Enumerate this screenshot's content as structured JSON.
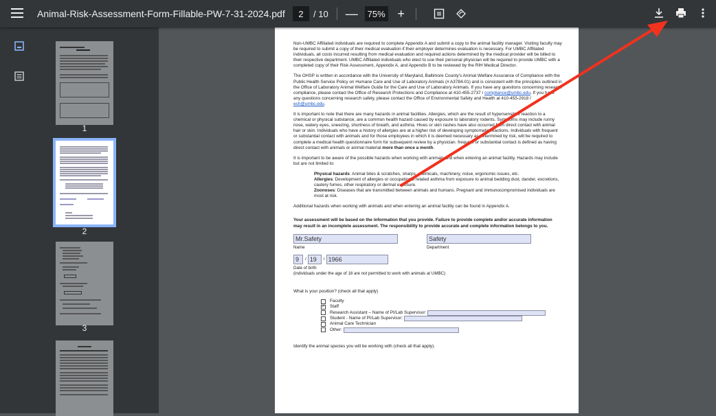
{
  "toolbar": {
    "title": "Animal-Risk-Assessment-Form-Fillable-PW-7-31-2024.pdf",
    "current_page": "2",
    "total_pages": "/ 10",
    "zoom": "75%",
    "zoom_out": "—",
    "zoom_in": "+"
  },
  "sidebar": {
    "thumbnails": [
      {
        "number": "1"
      },
      {
        "number": "2"
      },
      {
        "number": "3"
      }
    ]
  },
  "document": {
    "para1": "Non-UMBC Affiliated individuals are required to complete Appendix A and submit a copy to the animal facility manager. Visiting faculty may be required to submit a copy of their medical evaluation if their employer determines evaluation is necessary. For UMBC Affiliated individuals, all costs incurred resulting from medical evaluation and required actions determined by the medical provider will be billed to their respective department. UMBC Affiliated individuals who elect to use their personal physician will be required to provide UMBC with a completed copy of their Risk Assessment, Appendix A, and Appendix B to be reviewed by the RIH Medical Director.",
    "para2a": "The OHSP is written in accordance with the University of Maryland, Baltimore County's Animal Welfare Assurance of Compliance with the Public Health Service Policy on Humane Care and Use of Laboratory Animals (# A3784-01) and is consistent with the principles outlined in the Office of Laboratory Animal Welfare Guide for the Care and Use of Laboratory Animals. If you have any questions concerning research compliance, please contact the Office of Research Protections and Compliance at 410-455-2737 / ",
    "para2_link1": "compliance@umbc.edu",
    "para2b": ". If you have any questions concerning research safety, please contact the Office of Environmental Safety and Health at 410-455-2918 / ",
    "para2_link2": "esh@umbc.edu",
    "para2c": ".",
    "para3a": "It is important to note that there are many hazards in animal facilities. Allergies, which are the result of hypersensitive reaction to a chemical or physical substance, are a common health hazard caused by exposure to laboratory rodents. Symptoms may include runny nose, watery eyes, sneezing, shortness of breath, and asthma. Hives or skin rashes have also occurred from direct contact with animal hair or skin. Individuals who have a history of allergies are at a higher risk of developing symptomatic reactions. Individuals with frequent or substantial contact with animals and for those employees in which it is deemed necessary as determined by risk, will be required to complete a medical health questionnaire form for subsequent review by a physician. frequent or substantial contact is defined as having direct contact with animals or animal material ",
    "para3_bold": "more than once a month",
    "para3b": ".",
    "para4": "It is important to be aware of the possible hazards when working with animals and when entering an animal facility. Hazards may include but are not limited to:",
    "hazards": [
      {
        "label": "Physical hazards",
        "text": ": Animal bites & scratches, sharps, chemicals, machinery, noise, ergonomic issues, etc."
      },
      {
        "label": "Allergies",
        "text": ": Development of allergies or occupational related asthma from exposure to animal bedding dust, dander, excretions, cautery fumes, other respiratory or dermal exposure."
      },
      {
        "label": "Zoonoses",
        "text": ": Diseases that are transmitted between animals and humans. Pregnant and immunocompromised individuals are most at risk."
      }
    ],
    "para5": "Additional hazards when working with animals and when entering an animal facility can be found in Appendix A.",
    "para6": "Your assessment will be based on the information that you provide.  Failure to provide complete and/or accurate information may result in an incomplete assessment.  The responsibility to provide accurate and complete information belongs to you.",
    "name_value": "Mr.Safety",
    "name_label": "Name",
    "department_value": "Safety",
    "department_label": "Department",
    "dob_month": "9",
    "dob_day": "19",
    "dob_year": "1966",
    "dob_sep1": "/",
    "dob_sep2": "/",
    "dob_label": "Date of birth",
    "dob_note": "(individuals under the age of 18 are not permitted to work with animals at UMBC)",
    "position_question": "What is your position? (check all that apply)",
    "positions": [
      {
        "label": "Faculty",
        "checked": ""
      },
      {
        "label": "Staff",
        "checked": "✓"
      },
      {
        "label": "Research Assistant – Name of PI/Lab Supervisor:",
        "checked": ""
      },
      {
        "label": "Student - Name of PI/Lab Supervisor:",
        "checked": ""
      },
      {
        "label": "Animal Care Technician",
        "checked": ""
      },
      {
        "label": "Other:",
        "checked": ""
      }
    ],
    "species_question": "Identify the animal species you will be working with (check all that apply)."
  },
  "colors": {
    "toolbar_bg": "#323639",
    "viewer_bg": "#525659",
    "active_thumb": "#8ab4f8",
    "form_field": "#dfe3f6",
    "arrow": "#f0321e"
  }
}
